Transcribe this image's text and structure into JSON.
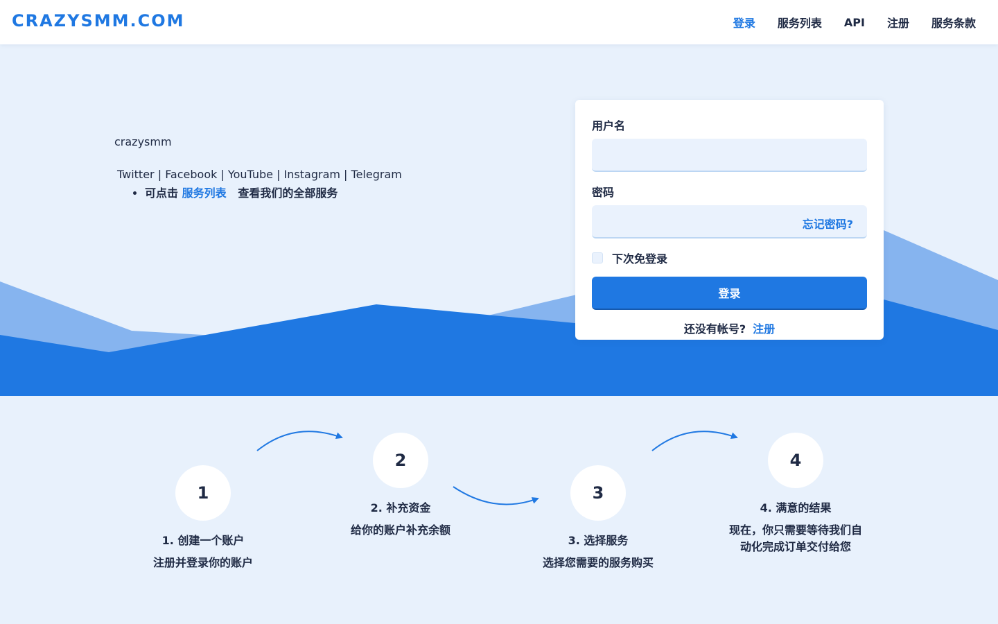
{
  "header": {
    "brand": "CRAZYSMM.COM",
    "nav": [
      "登录",
      "服务列表",
      "API",
      "注册",
      "服务条款"
    ]
  },
  "intro": {
    "site_name": "crazysmm",
    "socials": "Twitter | Facebook | YouTube | Instagram | Telegram",
    "bullet_prefix": "可点击",
    "bullet_link": "服务列表",
    "bullet_suffix": "查看我们的全部服务"
  },
  "login": {
    "username_label": "用户名",
    "username_value": "",
    "password_label": "密码",
    "password_value": "",
    "forgot": "忘记密码?",
    "remember": "下次免登录",
    "submit": "登录",
    "no_account": "还没有帐号?",
    "register": "注册"
  },
  "steps": [
    {
      "number": "1",
      "title": "1. 创建一个账户",
      "desc": "注册并登录你的账户"
    },
    {
      "number": "2",
      "title": "2. 补充资金",
      "desc": "给你的账户补充余额"
    },
    {
      "number": "3",
      "title": "3. 选择服务",
      "desc": "选择您需要的服务购买"
    },
    {
      "number": "4",
      "title": "4. 满意的结果",
      "desc": "现在，你只需要等待我们自动化完成订单交付给您"
    }
  ],
  "colors": {
    "accent": "#1f78e2",
    "wave_light": "#86b4ef",
    "background": "#e8f1fc"
  }
}
